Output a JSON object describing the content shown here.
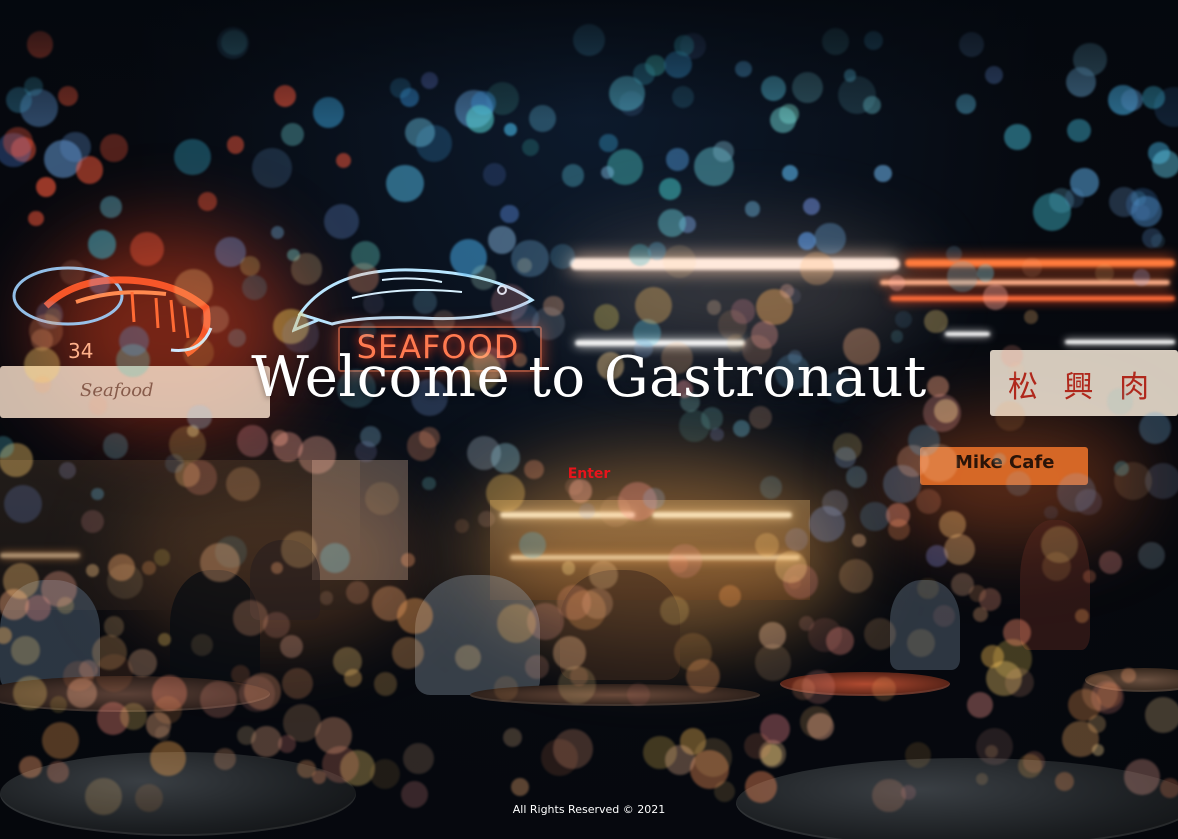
{
  "hero": {
    "title": "Welcome to Gastronaut",
    "enter_label": "Enter"
  },
  "footer": {
    "copyright": "All Rights Reserved © 2021"
  },
  "background": {
    "neon_signs": [
      "SEAFOOD",
      "34",
      "松 興 肉",
      "Mike Cafe"
    ]
  },
  "colors": {
    "title": "#ffffff",
    "enter": "#e8141b",
    "footer": "#ffffff",
    "page_bg": "#070b13"
  }
}
